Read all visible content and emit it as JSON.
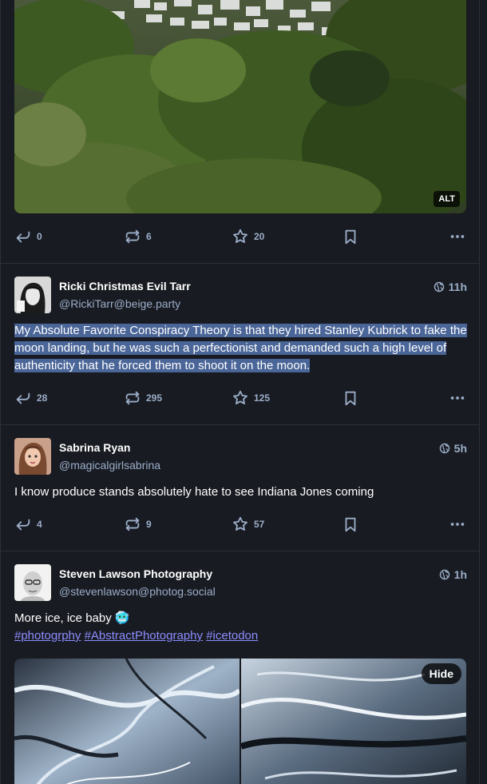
{
  "status1": {
    "alt_label": "ALT",
    "replies": "0",
    "boosts": "6",
    "favourites": "20"
  },
  "status2": {
    "display_name": "Ricki Christmas Evil Tarr",
    "acct": "@RickiTarr@beige.party",
    "time": "11h",
    "text": "My Absolute Favorite Conspiracy Theory is that they hired Stanley Kubrick to fake the moon landing, but he was such a perfectionist and demanded such a high level of authenticity that he forced them to shoot it on the moon.",
    "replies": "28",
    "boosts": "295",
    "favourites": "125"
  },
  "status3": {
    "display_name": "Sabrina Ryan",
    "acct": "@magicalgirlsabrina",
    "time": "5h",
    "text": "I know produce stands absolutely hate to see Indiana Jones coming",
    "replies": "4",
    "boosts": "9",
    "favourites": "57"
  },
  "status4": {
    "display_name": "Steven Lawson Photography",
    "acct": "@stevenlawson@photog.social",
    "time": "1h",
    "text": "More ice, ice baby",
    "emoji": "🥶",
    "hashtags": [
      "#photogrphy",
      "#AbstractPhotography",
      "#icetodon"
    ],
    "hide_label": "Hide"
  },
  "icons": {
    "reply": "reply-icon",
    "boost": "boost-icon",
    "favourite": "star-icon",
    "bookmark": "bookmark-icon",
    "more": "more-icon",
    "visibility": "globe-icon"
  },
  "colors": {
    "background": "#191b22",
    "text_secondary": "#9baec8",
    "hashtag": "#8c8dff",
    "selection": "#4a6597"
  }
}
